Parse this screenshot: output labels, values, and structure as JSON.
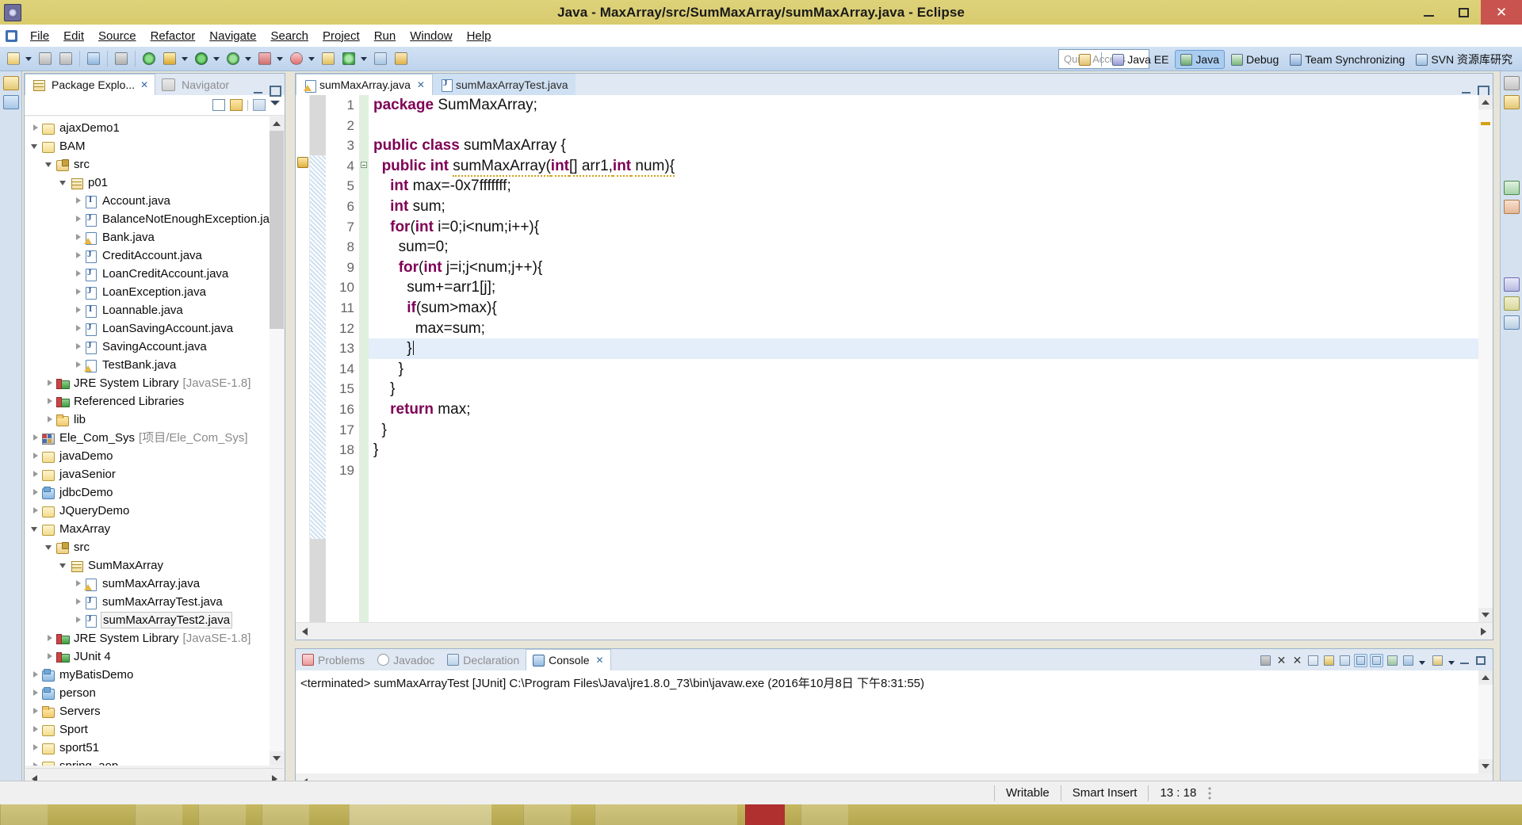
{
  "window": {
    "title": "Java - MaxArray/src/SumMaxArray/sumMaxArray.java - Eclipse",
    "app_icon": "eclipse-icon",
    "minimize_label": "Minimize",
    "maximize_label": "Restore",
    "close_label": "Close"
  },
  "menubar": {
    "items": [
      {
        "label": "File"
      },
      {
        "label": "Edit"
      },
      {
        "label": "Source"
      },
      {
        "label": "Refactor"
      },
      {
        "label": "Navigate"
      },
      {
        "label": "Search"
      },
      {
        "label": "Project"
      },
      {
        "label": "Run"
      },
      {
        "label": "Window"
      },
      {
        "label": "Help"
      }
    ]
  },
  "toolbar": {
    "icons": [
      "new-wizard-icon",
      "new-dropdown-arrow",
      "save-icon",
      "save-all-icon",
      "console-icon",
      "toggle-breakpoint-icon",
      "run-last-tool-icon",
      "external-tools-icon",
      "external-tools-arrow",
      "run-icon",
      "run-arrow",
      "debug-icon",
      "debug-arrow",
      "coverage-icon",
      "coverage-arrow",
      "profile-icon",
      "profile-arrow",
      "new-java-package-icon",
      "new-java-class-icon",
      "new-class-arrow",
      "open-type-icon",
      "open-task-icon"
    ]
  },
  "quick_access": {
    "placeholder": "Quick Access",
    "value": ""
  },
  "perspectives": {
    "restore_icon": "restore-perspective-icon",
    "items": [
      {
        "label": "Java EE",
        "icon": "java-ee-perspective-icon",
        "active": false
      },
      {
        "label": "Java",
        "icon": "java-perspective-icon",
        "active": true
      },
      {
        "label": "Debug",
        "icon": "debug-perspective-icon",
        "active": false
      },
      {
        "label": "Team Synchronizing",
        "icon": "team-sync-perspective-icon",
        "active": false
      },
      {
        "label": "SVN 资源库研究",
        "icon": "svn-perspective-icon",
        "active": false
      }
    ]
  },
  "package_explorer": {
    "tabs": [
      {
        "label": "Package Explo...",
        "icon": "package-explorer-icon",
        "active": true,
        "close": "✕"
      },
      {
        "label": "Navigator",
        "icon": "navigator-icon",
        "active": false
      }
    ],
    "toolbar_icons": [
      "collapse-all-icon",
      "link-with-editor-icon",
      "view-menu-icon",
      "minimize-icon",
      "maximize-icon"
    ],
    "tree": [
      {
        "label": "ajaxDemo1",
        "indent": 0,
        "arrow": "closed",
        "icon": "ic-projw",
        "iconName": "java-web-project-icon",
        "dim": "",
        "selected": false
      },
      {
        "label": "BAM",
        "indent": 0,
        "arrow": "open",
        "icon": "ic-projw",
        "iconName": "java-project-icon",
        "dim": "",
        "selected": false
      },
      {
        "label": "src",
        "indent": 1,
        "arrow": "open",
        "icon": "ic-src",
        "iconName": "source-folder-icon",
        "dim": "",
        "selected": false
      },
      {
        "label": "p01",
        "indent": 2,
        "arrow": "open",
        "icon": "ic-pkg",
        "iconName": "package-icon",
        "dim": "",
        "selected": false
      },
      {
        "label": "Account.java",
        "indent": 3,
        "arrow": "closed",
        "icon": "ic-iface",
        "iconName": "java-abstract-class-icon",
        "dim": "",
        "selected": false
      },
      {
        "label": "BalanceNotEnoughException.java",
        "indent": 3,
        "arrow": "closed",
        "icon": "ic-java",
        "iconName": "java-class-icon",
        "dim": "",
        "selected": false
      },
      {
        "label": "Bank.java",
        "indent": 3,
        "arrow": "closed",
        "icon": "ic-javaw",
        "iconName": "java-class-warning-icon",
        "dim": "",
        "selected": false
      },
      {
        "label": "CreditAccount.java",
        "indent": 3,
        "arrow": "closed",
        "icon": "ic-java",
        "iconName": "java-class-icon",
        "dim": "",
        "selected": false
      },
      {
        "label": "LoanCreditAccount.java",
        "indent": 3,
        "arrow": "closed",
        "icon": "ic-java",
        "iconName": "java-class-icon",
        "dim": "",
        "selected": false
      },
      {
        "label": "LoanException.java",
        "indent": 3,
        "arrow": "closed",
        "icon": "ic-java",
        "iconName": "java-class-icon",
        "dim": "",
        "selected": false
      },
      {
        "label": "Loannable.java",
        "indent": 3,
        "arrow": "closed",
        "icon": "ic-iface",
        "iconName": "java-interface-icon",
        "dim": "",
        "selected": false
      },
      {
        "label": "LoanSavingAccount.java",
        "indent": 3,
        "arrow": "closed",
        "icon": "ic-java",
        "iconName": "java-class-icon",
        "dim": "",
        "selected": false
      },
      {
        "label": "SavingAccount.java",
        "indent": 3,
        "arrow": "closed",
        "icon": "ic-java",
        "iconName": "java-class-icon",
        "dim": "",
        "selected": false
      },
      {
        "label": "TestBank.java",
        "indent": 3,
        "arrow": "closed",
        "icon": "ic-javaw",
        "iconName": "java-class-warning-icon",
        "dim": "",
        "selected": false
      },
      {
        "label": "JRE System Library",
        "indent": 1,
        "arrow": "closed",
        "icon": "ic-lib",
        "iconName": "jre-library-icon",
        "dim": "[JavaSE-1.8]",
        "selected": false
      },
      {
        "label": "Referenced Libraries",
        "indent": 1,
        "arrow": "closed",
        "icon": "ic-lib",
        "iconName": "referenced-libraries-icon",
        "dim": "",
        "selected": false
      },
      {
        "label": "lib",
        "indent": 1,
        "arrow": "closed",
        "icon": "ic-folder",
        "iconName": "folder-icon",
        "dim": "",
        "selected": false
      },
      {
        "label": "Ele_Com_Sys",
        "indent": 0,
        "arrow": "closed",
        "icon": "ic-web",
        "iconName": "web-project-icon",
        "dim": "[项目/Ele_Com_Sys]",
        "selected": false
      },
      {
        "label": "javaDemo",
        "indent": 0,
        "arrow": "closed",
        "icon": "ic-projw",
        "iconName": "java-project-icon",
        "dim": "",
        "selected": false
      },
      {
        "label": "javaSenior",
        "indent": 0,
        "arrow": "closed",
        "icon": "ic-projw",
        "iconName": "java-project-icon",
        "dim": "",
        "selected": false
      },
      {
        "label": "jdbcDemo",
        "indent": 0,
        "arrow": "closed",
        "icon": "ic-proj",
        "iconName": "java-project-icon",
        "dim": "",
        "selected": false
      },
      {
        "label": "JQueryDemo",
        "indent": 0,
        "arrow": "closed",
        "icon": "ic-projw",
        "iconName": "java-web-project-icon",
        "dim": "",
        "selected": false
      },
      {
        "label": "MaxArray",
        "indent": 0,
        "arrow": "open",
        "icon": "ic-projw",
        "iconName": "java-project-icon",
        "dim": "",
        "selected": false
      },
      {
        "label": "src",
        "indent": 1,
        "arrow": "open",
        "icon": "ic-src",
        "iconName": "source-folder-icon",
        "dim": "",
        "selected": false
      },
      {
        "label": "SumMaxArray",
        "indent": 2,
        "arrow": "open",
        "icon": "ic-pkg",
        "iconName": "package-icon",
        "dim": "",
        "selected": false
      },
      {
        "label": "sumMaxArray.java",
        "indent": 3,
        "arrow": "closed",
        "icon": "ic-javaw",
        "iconName": "java-class-warning-icon",
        "dim": "",
        "selected": false
      },
      {
        "label": "sumMaxArrayTest.java",
        "indent": 3,
        "arrow": "closed",
        "icon": "ic-java",
        "iconName": "java-class-icon",
        "dim": "",
        "selected": false
      },
      {
        "label": "sumMaxArrayTest2.java",
        "indent": 3,
        "arrow": "closed",
        "icon": "ic-java",
        "iconName": "java-class-icon",
        "dim": "",
        "selected": true
      },
      {
        "label": "JRE System Library",
        "indent": 1,
        "arrow": "closed",
        "icon": "ic-lib",
        "iconName": "jre-library-icon",
        "dim": "[JavaSE-1.8]",
        "selected": false
      },
      {
        "label": "JUnit 4",
        "indent": 1,
        "arrow": "closed",
        "icon": "ic-junit",
        "iconName": "junit-library-icon",
        "dim": "",
        "selected": false
      },
      {
        "label": "myBatisDemo",
        "indent": 0,
        "arrow": "closed",
        "icon": "ic-proj",
        "iconName": "java-project-icon",
        "dim": "",
        "selected": false
      },
      {
        "label": "person",
        "indent": 0,
        "arrow": "closed",
        "icon": "ic-proj",
        "iconName": "java-project-icon",
        "dim": "",
        "selected": false
      },
      {
        "label": "Servers",
        "indent": 0,
        "arrow": "closed",
        "icon": "ic-folder",
        "iconName": "servers-folder-icon",
        "dim": "",
        "selected": false
      },
      {
        "label": "Sport",
        "indent": 0,
        "arrow": "closed",
        "icon": "ic-projw",
        "iconName": "java-project-icon",
        "dim": "",
        "selected": false
      },
      {
        "label": "sport51",
        "indent": 0,
        "arrow": "closed",
        "icon": "ic-projw",
        "iconName": "java-project-icon",
        "dim": "",
        "selected": false
      },
      {
        "label": "spring_aop",
        "indent": 0,
        "arrow": "closed",
        "icon": "ic-projw",
        "iconName": "java-project-icon",
        "dim": "",
        "selected": false
      }
    ]
  },
  "editor": {
    "tabs": [
      {
        "label": "sumMaxArray.java",
        "icon": "java-class-warning-icon",
        "active": true,
        "close": "✕"
      },
      {
        "label": "sumMaxArrayTest.java",
        "icon": "java-class-icon",
        "active": false
      }
    ],
    "lines": [
      {
        "no": "1",
        "segments": [
          {
            "t": "package ",
            "k": true
          },
          {
            "t": "SumMaxArray;"
          }
        ]
      },
      {
        "no": "2",
        "segments": []
      },
      {
        "no": "3",
        "segments": [
          {
            "t": "public class ",
            "k": true
          },
          {
            "t": "sumMaxArray {"
          }
        ]
      },
      {
        "no": "4",
        "segments": [
          {
            "t": "  "
          },
          {
            "t": "public int ",
            "k": true
          },
          {
            "t": "sumMaxArray(",
            "u": true
          },
          {
            "t": "int",
            "k": true,
            "u": true
          },
          {
            "t": "[] arr1,",
            "u": true
          },
          {
            "t": "int",
            "k": true,
            "u": true
          },
          {
            "t": " num){",
            "u": true
          }
        ]
      },
      {
        "no": "5",
        "segments": [
          {
            "t": "    "
          },
          {
            "t": "int",
            "k": true
          },
          {
            "t": " max=-0x7fffffff;"
          }
        ]
      },
      {
        "no": "6",
        "segments": [
          {
            "t": "    "
          },
          {
            "t": "int",
            "k": true
          },
          {
            "t": " sum;"
          }
        ]
      },
      {
        "no": "7",
        "segments": [
          {
            "t": "    "
          },
          {
            "t": "for",
            "k": true
          },
          {
            "t": "("
          },
          {
            "t": "int",
            "k": true
          },
          {
            "t": " i=0;i<num;i++){"
          }
        ]
      },
      {
        "no": "8",
        "segments": [
          {
            "t": "      sum=0;"
          }
        ]
      },
      {
        "no": "9",
        "segments": [
          {
            "t": "      "
          },
          {
            "t": "for",
            "k": true
          },
          {
            "t": "("
          },
          {
            "t": "int",
            "k": true
          },
          {
            "t": " j=i;j<num;j++){"
          }
        ]
      },
      {
        "no": "10",
        "segments": [
          {
            "t": "        sum+=arr1[j];"
          }
        ]
      },
      {
        "no": "11",
        "segments": [
          {
            "t": "        "
          },
          {
            "t": "if",
            "k": true
          },
          {
            "t": "(sum>max){"
          }
        ]
      },
      {
        "no": "12",
        "segments": [
          {
            "t": "          max=sum;"
          }
        ]
      },
      {
        "no": "13",
        "segments": [
          {
            "t": "        }"
          }
        ],
        "current": true,
        "caret": true
      },
      {
        "no": "14",
        "segments": [
          {
            "t": "      }"
          }
        ]
      },
      {
        "no": "15",
        "segments": [
          {
            "t": "    }"
          }
        ]
      },
      {
        "no": "16",
        "segments": [
          {
            "t": "    "
          },
          {
            "t": "return",
            "k": true
          },
          {
            "t": " max;"
          }
        ]
      },
      {
        "no": "17",
        "segments": [
          {
            "t": "  }"
          }
        ]
      },
      {
        "no": "18",
        "segments": [
          {
            "t": "}"
          }
        ]
      },
      {
        "no": "19",
        "segments": []
      }
    ]
  },
  "console": {
    "tabs": [
      {
        "label": "Problems",
        "icon": "problems-icon",
        "active": false
      },
      {
        "label": "Javadoc",
        "icon": "javadoc-icon",
        "active": false
      },
      {
        "label": "Declaration",
        "icon": "declaration-icon",
        "active": false
      },
      {
        "label": "Console",
        "icon": "console-icon",
        "active": true,
        "close": "✕"
      }
    ],
    "toolbar_icons": [
      "terminate-icon",
      "remove-launch-icon",
      "remove-all-terminated-icon",
      "clear-console-icon",
      "scroll-lock-icon",
      "word-wrap-icon",
      "show-console-on-output-icon",
      "show-console-on-error-icon",
      "pin-console-icon",
      "display-selected-console-icon",
      "display-selected-console-arrow",
      "open-console-icon",
      "open-console-arrow",
      "minimize-icon",
      "maximize-icon"
    ],
    "output": "<terminated> sumMaxArrayTest [JUnit] C:\\Program Files\\Java\\jre1.8.0_73\\bin\\javaw.exe (2016年10月8日 下午8:31:55)"
  },
  "statusbar": {
    "writable": "Writable",
    "insert_mode": "Smart Insert",
    "position": "13 : 18"
  },
  "colors": {
    "title_bar": "#ded27a",
    "keyword": "#7f0055",
    "current_line": "#e3eefa",
    "toolbar": "#bdd3ec",
    "accent": "#a9cdf0"
  }
}
